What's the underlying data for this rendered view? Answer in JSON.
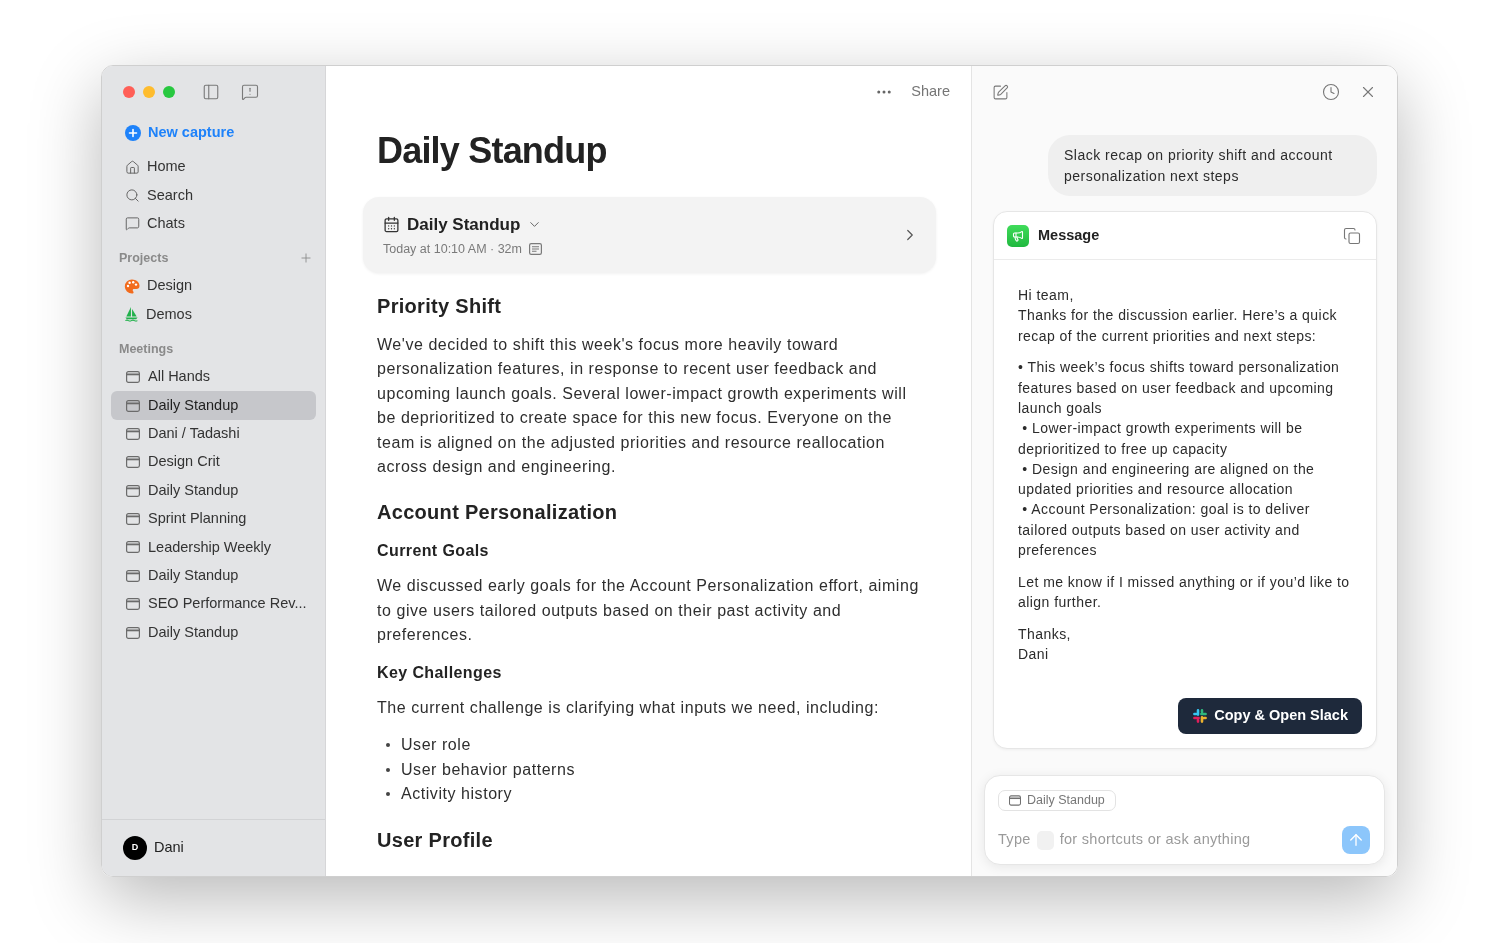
{
  "sidebar": {
    "new_capture": "New capture",
    "nav": [
      {
        "kind": "home",
        "label": "Home"
      },
      {
        "kind": "search",
        "label": "Search"
      },
      {
        "kind": "chats",
        "label": "Chats"
      }
    ],
    "projects": {
      "title": "Projects",
      "items": [
        {
          "kind": "palette",
          "label": "Design"
        },
        {
          "kind": "sailboat",
          "label": "Demos"
        }
      ]
    },
    "meetings": {
      "title": "Meetings",
      "items": [
        {
          "label": "All Hands",
          "selected": false
        },
        {
          "label": "Daily Standup",
          "selected": true
        },
        {
          "label": "Dani / Tadashi",
          "selected": false
        },
        {
          "label": "Design Crit",
          "selected": false
        },
        {
          "label": "Daily Standup",
          "selected": false
        },
        {
          "label": "Sprint Planning",
          "selected": false
        },
        {
          "label": "Leadership Weekly",
          "selected": false
        },
        {
          "label": "Daily Standup",
          "selected": false
        },
        {
          "label": "SEO Performance Rev...",
          "selected": false
        },
        {
          "label": "Daily Standup",
          "selected": false
        }
      ]
    },
    "user": {
      "initial": "D",
      "name": "Dani"
    }
  },
  "main": {
    "toolbar": {
      "share": "Share"
    },
    "title": "Daily Standup",
    "meeting_card": {
      "title": "Daily Standup",
      "meta": "Today at 10:10 AM · 32m"
    },
    "blocks": [
      {
        "kind": "heading",
        "text": "Priority Shift"
      },
      {
        "kind": "paragraph",
        "text": "We've decided to shift this week's focus more heavily toward personalization features, in response to recent user feedback and upcoming launch goals. Several lower-impact growth experiments will be deprioritized to create space for this new focus. Everyone on the team is aligned on the adjusted priorities and resource reallocation across design and engineering."
      },
      {
        "kind": "heading",
        "text": "Account Personalization"
      },
      {
        "kind": "subheading",
        "text": "Current Goals"
      },
      {
        "kind": "paragraph",
        "text": "We discussed early goals for the Account Personalization effort, aiming to give users tailored outputs based on their past activity and preferences."
      },
      {
        "kind": "subheading",
        "text": "Key Challenges"
      },
      {
        "kind": "paragraph",
        "text": "The current challenge is clarifying what inputs we need, including:"
      },
      {
        "kind": "bullets",
        "items": [
          "User role",
          "User behavior patterns",
          "Activity history"
        ]
      },
      {
        "kind": "heading",
        "text": "User Profile"
      }
    ]
  },
  "assistant": {
    "prompt": "Slack recap on priority shift and account personalization next steps",
    "message_card": {
      "title": "Message",
      "paragraphs": [
        [
          "Hi team,",
          "Thanks for the discussion earlier. Here’s a quick recap of the current priorities and next steps:"
        ],
        [
          "• This week’s focus shifts toward personalization features based on user feedback and upcoming launch goals",
          " • Lower-impact growth experiments will be deprioritized to free up capacity",
          " • Design and engineering are aligned on the updated priorities and resource allocation",
          " • Account Personalization: goal is to deliver tailored outputs based on user activity and preferences"
        ],
        [
          "Let me know if I missed anything or if you’d like to align further."
        ],
        [
          "Thanks,",
          "Dani"
        ]
      ],
      "action": "Copy & Open Slack"
    },
    "composer": {
      "context_chip": "Daily Standup",
      "placeholder": [
        "Type",
        "for shortcuts or ask anything"
      ],
      "send_disabled": true
    }
  }
}
